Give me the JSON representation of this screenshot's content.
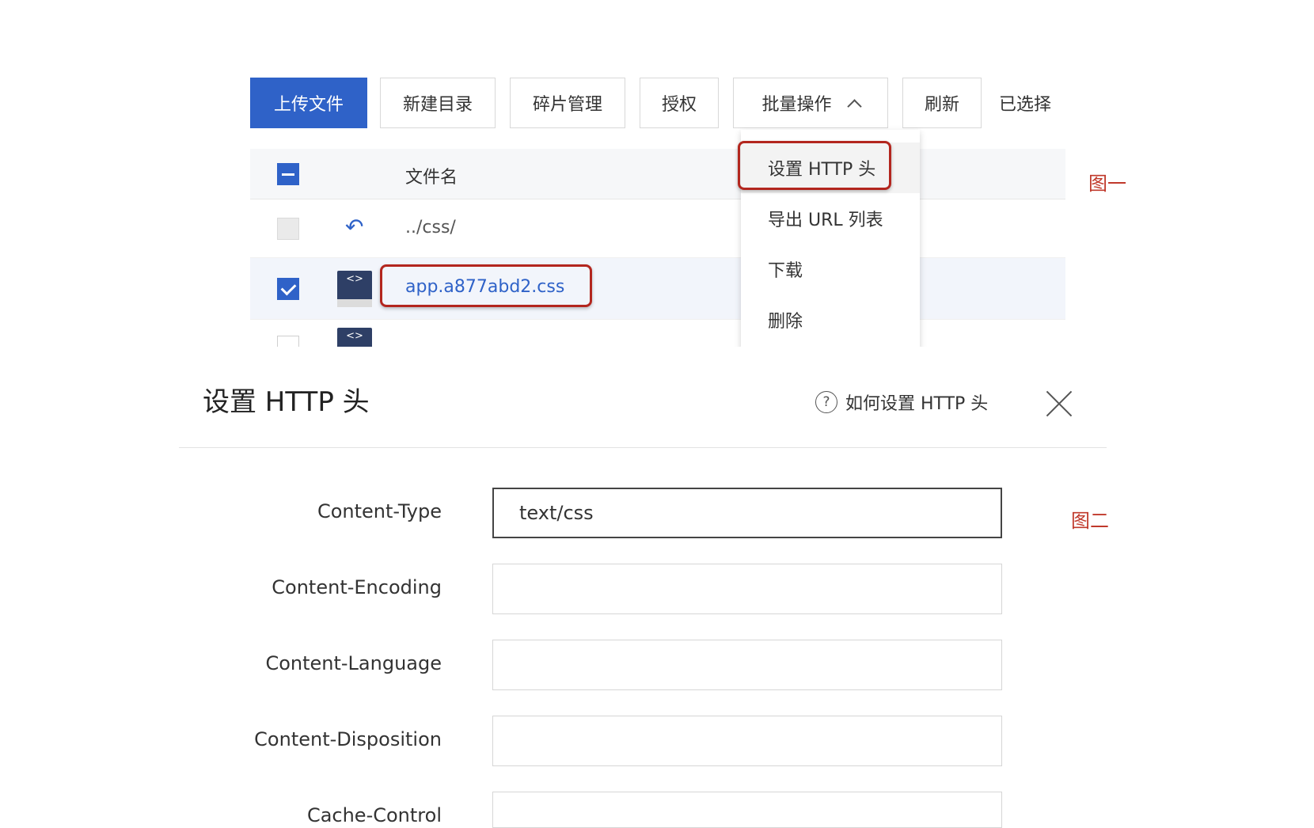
{
  "figure1": {
    "toolbar": {
      "upload": "上传文件",
      "new_dir": "新建目录",
      "fragments": "碎片管理",
      "authorize": "授权",
      "batch": "批量操作",
      "refresh": "刷新",
      "selected": "已选择"
    },
    "table": {
      "header_name": "文件名",
      "rows": [
        {
          "name": "../css/",
          "type": "parent"
        },
        {
          "name": "app.a877abd2.css",
          "type": "file",
          "checked": true
        }
      ]
    },
    "dropdown": {
      "items": [
        "设置 HTTP 头",
        "导出 URL 列表",
        "下载",
        "删除"
      ]
    },
    "caption": "图一"
  },
  "figure2": {
    "title": "设置 HTTP 头",
    "help_link": "如何设置 HTTP 头",
    "fields": [
      {
        "label": "Content-Type",
        "value": "text/css"
      },
      {
        "label": "Content-Encoding",
        "value": ""
      },
      {
        "label": "Content-Language",
        "value": ""
      },
      {
        "label": "Content-Disposition",
        "value": ""
      },
      {
        "label": "Cache-Control",
        "value": ""
      }
    ],
    "caption": "图二"
  },
  "colors": {
    "primary": "#2f62c8",
    "highlight": "#b3261e",
    "caption": "#c0392b"
  },
  "icons": [
    "chevron-up-icon",
    "back-arrow-icon",
    "code-file-icon",
    "help-icon",
    "close-icon"
  ]
}
